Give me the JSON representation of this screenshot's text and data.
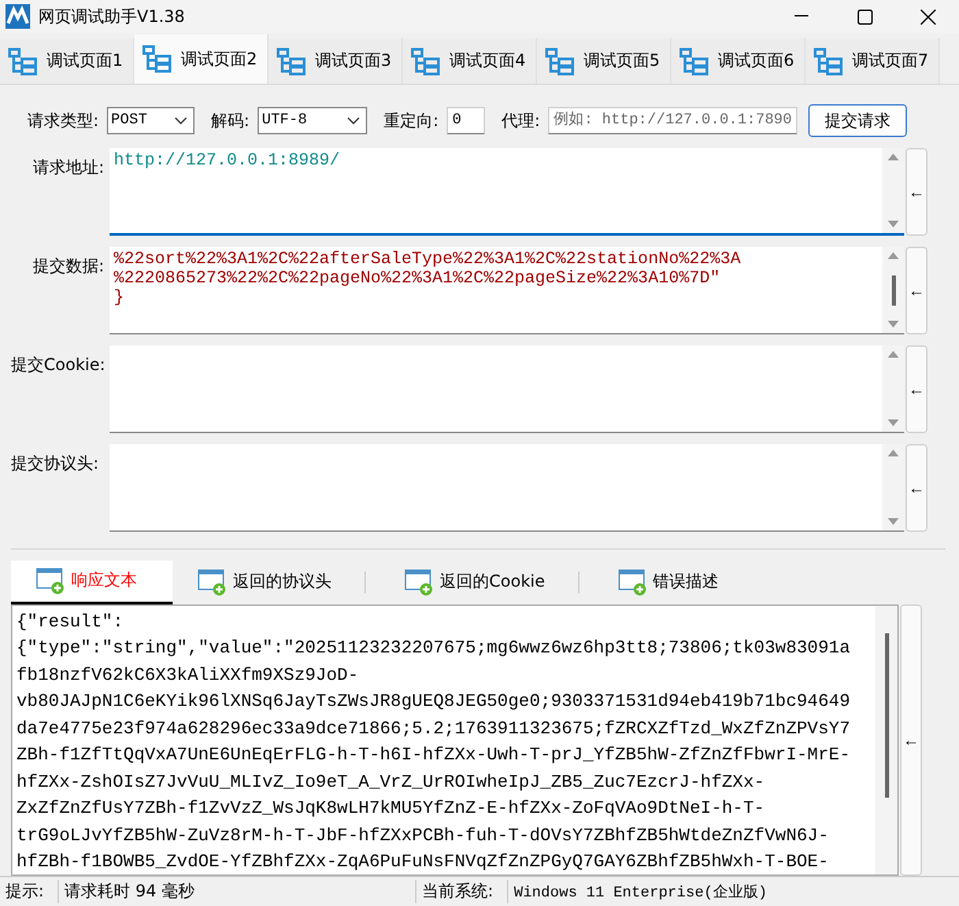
{
  "window": {
    "title": "网页调试助手V1.38"
  },
  "tabs": [
    {
      "label": "调试页面1",
      "selected": false
    },
    {
      "label": "调试页面2",
      "selected": true
    },
    {
      "label": "调试页面3",
      "selected": false
    },
    {
      "label": "调试页面4",
      "selected": false
    },
    {
      "label": "调试页面5",
      "selected": false
    },
    {
      "label": "调试页面6",
      "selected": false
    },
    {
      "label": "调试页面7",
      "selected": false
    }
  ],
  "options": {
    "method": {
      "label": "请求类型:",
      "value": "POST"
    },
    "encoding": {
      "label": "解码:",
      "value": "UTF-8"
    },
    "redirect": {
      "label": "重定向:",
      "value": "0"
    },
    "proxy": {
      "label": "代理:",
      "placeholder": "例如: http://127.0.0.1:7890"
    },
    "submit": "提交请求"
  },
  "fields": [
    {
      "label": "请求地址:",
      "kind": "url",
      "focused": true,
      "lines": [
        "http://127.0.0.1:8989/"
      ],
      "side_button": "←"
    },
    {
      "label": "提交数据:",
      "kind": "data",
      "focused": false,
      "lines": [
        "%22sort%22%3A1%2C%22afterSaleType%22%3A1%2C%22stationNo%22%3A",
        "%2220865273%22%2C%22pageNo%22%3A1%2C%22pageSize%22%3A10%7D\"",
        "}"
      ],
      "side_button": "←"
    },
    {
      "label": "提交Cookie:",
      "kind": "text",
      "focused": false,
      "side_button": "←"
    },
    {
      "label": "提交协议头:",
      "kind": "text",
      "focused": false,
      "side_button": "←"
    }
  ],
  "result_tabs": [
    {
      "label": "响应文本",
      "selected": true
    },
    {
      "label": "返回的协议头",
      "selected": false
    },
    {
      "label": "返回的Cookie",
      "selected": false
    },
    {
      "label": "错误描述",
      "selected": false
    }
  ],
  "response": {
    "lines": [
      "{\"result\":",
      "{\"type\":\"string\",\"value\":\"20251123232207675;mg6wwz6wz6hp3tt8;73806;tk03w83091a",
      "fb18nzfV62kC6X3kAliXXfm9XSz9JoD-",
      "vb80JAJpN1C6eKYik96lXNSq6JayTsZWsJR8gUEQ8JEG50ge0;9303371531d94eb419b71bc94649",
      "da7e4775e23f974a628296ec33a9dce71866;5.2;1763911323675;fZRCXZfTzd_WxZfZnZPVsY7",
      "ZBh-f1ZfTtQqVxA7UnE6UnEqErFLG-h-T-h6I-hfZXx-Uwh-T-prJ_YfZB5hW-ZfZnZfFbwrI-MrE-",
      "hfZXx-ZshOIsZ7JvVuU_MLIvZ_Io9eT_A_VrZ_UrROIwheIpJ_ZB5_Zuc7EzcrJ-hfZXx-",
      "ZxZfZnZfUsY7ZBh-f1ZvVzZ_WsJqK8wLH7kMU5YfZnZ-E-hfZXx-ZoFqVAo9DtNeI-h-T-",
      "trG9oLJvYfZB5hW-ZuVz8rM-h-T-JbF-hfZXxPCBh-fuh-T-dOVsY7ZBhfZB5hWtdeZnZfVwN6J-",
      "hfZBh-f1BOWB5_ZvdOE-YfZBhfZXx-ZqA6PuFuNsFNVqZfZnZPGyQ7GAY6ZBhfZB5hWxh-T-BOE-"
    ],
    "side_button": "←"
  },
  "status_bar": {
    "hint_label": "提示:",
    "hint": "请求耗时 94 毫秒",
    "system_label": "当前系统:",
    "system": "Windows 11 Enterprise(企业版)"
  }
}
